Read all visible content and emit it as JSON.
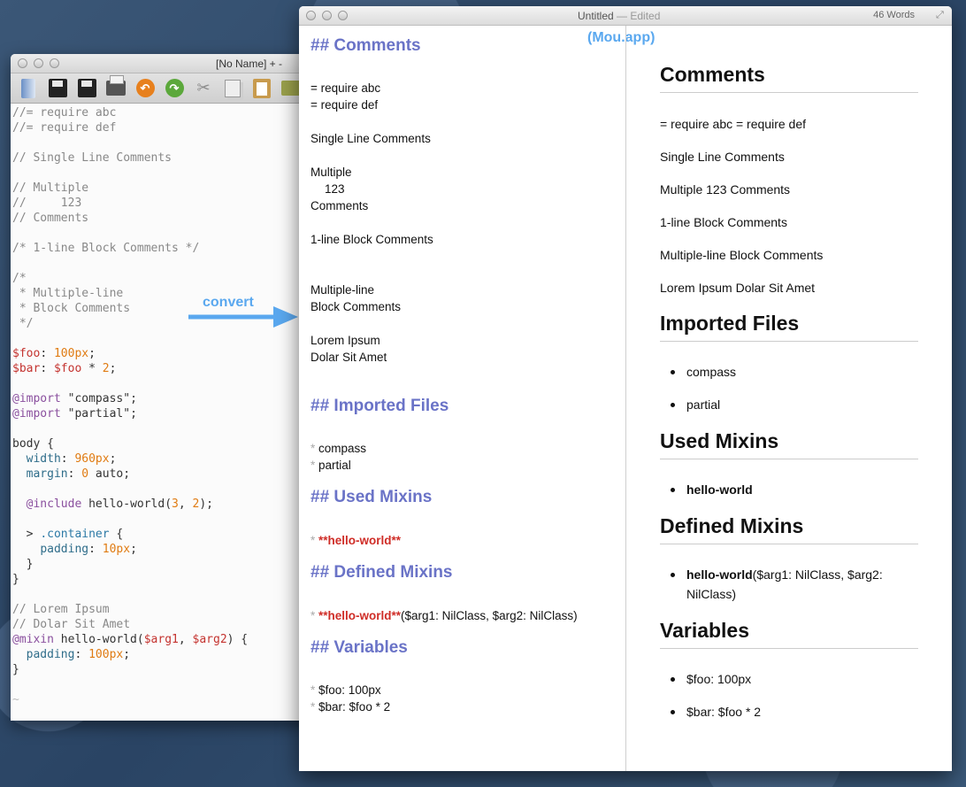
{
  "vim": {
    "title": "[No Name] + -",
    "toolbar_icons": [
      "new-doc-icon",
      "save-icon",
      "save-all-icon",
      "print-icon",
      "undo-icon",
      "redo-icon",
      "cut-icon",
      "copy-icon",
      "paste-icon",
      "open-folder-icon"
    ],
    "lines": [
      "//= require abc",
      "//= require def",
      "",
      "// Single Line Comments",
      "",
      "// Multiple",
      "//     123",
      "// Comments",
      "",
      "/* 1-line Block Comments */",
      "",
      "/*",
      " * Multiple-line",
      " * Block Comments",
      " */",
      "",
      "$foo: 100px;",
      "$bar: $foo * 2;",
      "",
      "@import \"compass\";",
      "@import \"partial\";",
      "",
      "body {",
      "  width: 960px;",
      "  margin: 0 auto;",
      "",
      "  @include hello-world(3, 2);",
      "",
      "  > .container {",
      "    padding: 10px;",
      "  }",
      "}",
      "",
      "// Lorem Ipsum",
      "// Dolar Sit Amet",
      "@mixin hello-world($arg1, $arg2) {",
      "  padding: 100px;",
      "}",
      "",
      "~"
    ]
  },
  "annotations": {
    "convert": "convert",
    "mou_app": "(Mou.app)"
  },
  "mou": {
    "title": "Untitled",
    "title_suffix": " — Edited",
    "word_count": "46 Words",
    "markdown": {
      "h_comments": "## Comments",
      "require_abc": "= require abc",
      "require_def": "= require def",
      "single_line": "Single Line Comments",
      "multiple": "Multiple",
      "num_123": "123",
      "comments": "Comments",
      "one_line_block": "1-line Block Comments",
      "multiple_line": "Multiple-line",
      "block_comments": "Block Comments",
      "lorem_ipsum": "Lorem Ipsum",
      "dolar_sit_amet": "Dolar Sit Amet",
      "h_imported": "## Imported Files",
      "star": "*",
      "compass": "compass",
      "partial": "partial",
      "h_used_mixins": "## Used Mixins",
      "hello_world_md": "**hello-world**",
      "h_defined_mixins": "## Defined Mixins",
      "defined_args": "($arg1: NilClass, $arg2: NilClass)",
      "h_variables": "## Variables",
      "foo": "$foo: 100px",
      "bar": "$bar: $foo * 2"
    },
    "preview": {
      "h_comments": "Comments",
      "p_requires": "= require abc = require def",
      "p_single": "Single Line Comments",
      "p_multiple": "Multiple 123 Comments",
      "p_one_line": "1-line Block Comments",
      "p_multi_line": "Multiple-line Block Comments",
      "p_lorem": "Lorem Ipsum Dolar Sit Amet",
      "h_imported": "Imported Files",
      "li_compass": "compass",
      "li_partial": "partial",
      "h_used_mixins": "Used Mixins",
      "li_hello_world": "hello-world",
      "h_defined_mixins": "Defined Mixins",
      "li_defined_name": "hello-world",
      "li_defined_args": "($arg1: NilClass, $arg2: NilClass)",
      "h_variables": "Variables",
      "li_foo": "$foo: 100px",
      "li_bar": "$bar: $foo * 2"
    }
  },
  "colors": {
    "markdown_heading": "#6a73c7",
    "markdown_bold": "#cf2d27",
    "annotation_blue": "#5aa8ef"
  }
}
